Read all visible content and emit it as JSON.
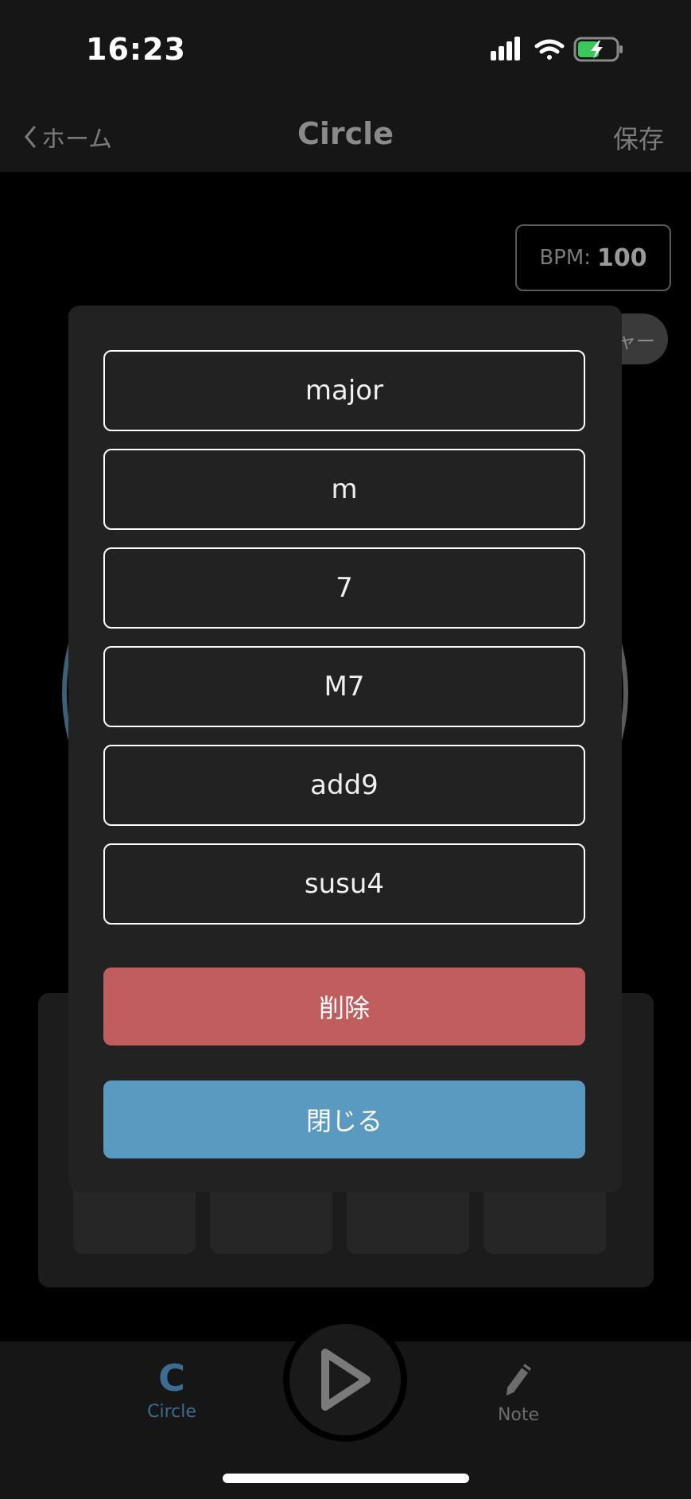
{
  "status_bar": {
    "time": "16:23"
  },
  "nav": {
    "back_label": "ホーム",
    "title": "Circle",
    "save_label": "保存"
  },
  "main": {
    "bpm_label": "BPM:",
    "bpm_value": "100",
    "pill_label": "ャー"
  },
  "modal": {
    "options": [
      "major",
      "m",
      "7",
      "M7",
      "add9",
      "susu4"
    ],
    "delete_label": "削除",
    "close_label": "閉じる"
  },
  "tab_bar": {
    "circle_glyph": "C",
    "circle_label": "Circle",
    "note_label": "Note"
  },
  "colors": {
    "delete": "#c05d5f",
    "close": "#5b9ac0",
    "tab_active": "#3c6c90"
  }
}
